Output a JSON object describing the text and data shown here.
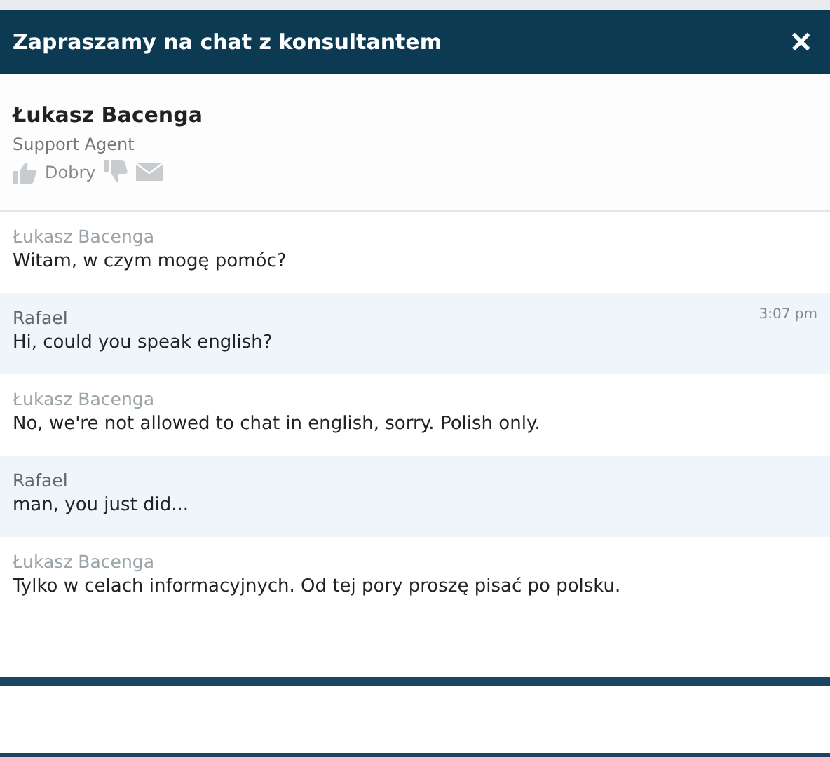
{
  "window": {
    "title": "Zapraszamy na chat z konsultantem",
    "close": "✕"
  },
  "agent": {
    "name": "Łukasz Bacenga",
    "role": "Support Agent",
    "rating_label": "Dobry"
  },
  "messages": [
    {
      "kind": "agent",
      "sender": "Łukasz Bacenga",
      "text": "Witam, w czym mogę pomóc?"
    },
    {
      "kind": "customer",
      "sender": "Rafael",
      "time": "3:07 pm",
      "text": "Hi, could you speak english?"
    },
    {
      "kind": "agent",
      "sender": "Łukasz Bacenga",
      "text": "No, we're not allowed to chat in english, sorry. Polish only."
    },
    {
      "kind": "customer",
      "sender": "Rafael",
      "text": "man, you just did..."
    },
    {
      "kind": "agent",
      "sender": "Łukasz Bacenga",
      "text": "Tylko w celach informacyjnych. Od tej pory proszę pisać po polsku."
    }
  ]
}
